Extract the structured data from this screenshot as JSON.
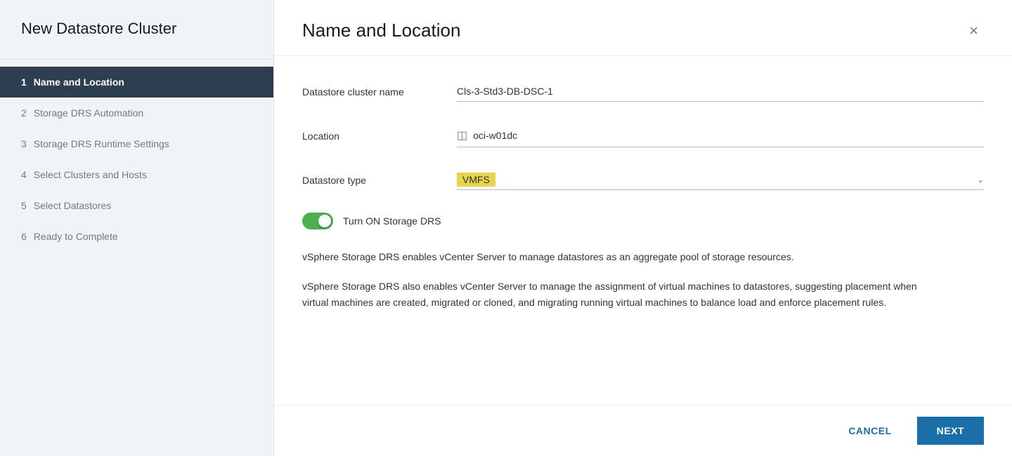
{
  "sidebar": {
    "title": "New Datastore Cluster",
    "steps": [
      {
        "num": "1",
        "label": "Name and Location",
        "active": true
      },
      {
        "num": "2",
        "label": "Storage DRS Automation",
        "active": false
      },
      {
        "num": "3",
        "label": "Storage DRS Runtime Settings",
        "active": false
      },
      {
        "num": "4",
        "label": "Select Clusters and Hosts",
        "active": false
      },
      {
        "num": "5",
        "label": "Select Datastores",
        "active": false
      },
      {
        "num": "6",
        "label": "Ready to Complete",
        "active": false
      }
    ]
  },
  "main": {
    "title": "Name and Location",
    "close_icon": "×",
    "form": {
      "cluster_name_label": "Datastore cluster name",
      "cluster_name_value": "Cls-3-Std3-DB-DSC-1",
      "location_label": "Location",
      "location_value": "oci-w01dc",
      "datastore_type_label": "Datastore type",
      "datastore_type_value": "VMFS",
      "toggle_label": "Turn ON Storage DRS",
      "desc1": "vSphere Storage DRS enables vCenter Server to manage datastores as an aggregate pool of storage resources.",
      "desc2": "vSphere Storage DRS also enables vCenter Server to manage the assignment of virtual machines to datastores, suggesting placement when virtual machines are created, migrated or cloned, and migrating running virtual machines to balance load and enforce placement rules."
    },
    "footer": {
      "cancel_label": "CANCEL",
      "next_label": "NEXT"
    }
  }
}
